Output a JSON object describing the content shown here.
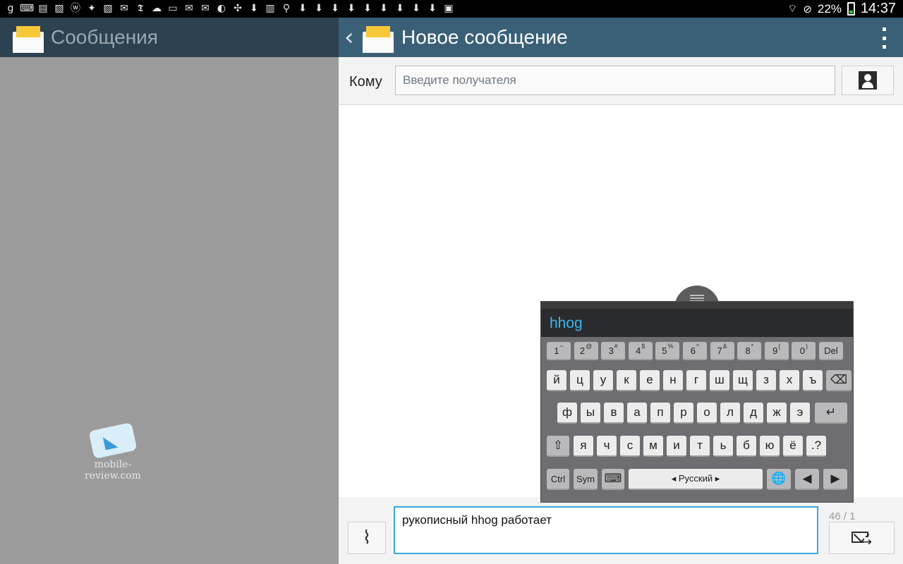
{
  "status_bar": {
    "icons": [
      "gplus-icon",
      "keyboard-icon",
      "sim-icon",
      "image-icon",
      "wordpress-icon",
      "dropbox-icon",
      "gallery-icon",
      "twitter-icon",
      "nyt-icon",
      "chat-icon",
      "window-icon",
      "mail-icon",
      "mail2-icon",
      "bag-icon",
      "pinwheel-icon",
      "download-icon",
      "store-icon",
      "pin-icon",
      "download2-icon",
      "download3-icon",
      "download4-icon",
      "download5-icon",
      "download6-icon",
      "download7-icon",
      "download8-icon",
      "download9-icon",
      "download10-icon",
      "briefcase-icon"
    ],
    "battery": "22%",
    "time": "14:37"
  },
  "left_pane": {
    "title": "Сообщения",
    "watermark": "mobile-review.com"
  },
  "right_pane": {
    "title": "Новое сообщение",
    "to_label": "Кому",
    "to_placeholder": "Введите получателя",
    "message_text": "рукописный hhog работает",
    "counter": "46 / 1"
  },
  "keyboard": {
    "prediction": "hhog",
    "layout_label": "Русский",
    "number_row": [
      {
        "k": "1",
        "s": "~"
      },
      {
        "k": "2",
        "s": "@"
      },
      {
        "k": "3",
        "s": "#"
      },
      {
        "k": "4",
        "s": "$"
      },
      {
        "k": "5",
        "s": "%"
      },
      {
        "k": "6",
        "s": "^"
      },
      {
        "k": "7",
        "s": "&"
      },
      {
        "k": "8",
        "s": "*"
      },
      {
        "k": "9",
        "s": "("
      },
      {
        "k": "0",
        "s": ")"
      }
    ],
    "del_label": "Del",
    "row1": [
      "й",
      "ц",
      "у",
      "к",
      "е",
      "н",
      "г",
      "ш",
      "щ",
      "з",
      "х",
      "ъ"
    ],
    "row2": [
      "ф",
      "ы",
      "в",
      "а",
      "п",
      "р",
      "о",
      "л",
      "д",
      "ж",
      "э"
    ],
    "row3": [
      "я",
      "ч",
      "с",
      "м",
      "и",
      "т",
      "ь",
      "б",
      "ю",
      "ё"
    ],
    "punct_key": ".?",
    "ctrl_label": "Ctrl",
    "sym_label": "Sym"
  },
  "colors": {
    "left_header": "#2d4250",
    "right_header": "#3a6078",
    "accent": "#3aa7e0",
    "prediction": "#3ab8ef"
  }
}
